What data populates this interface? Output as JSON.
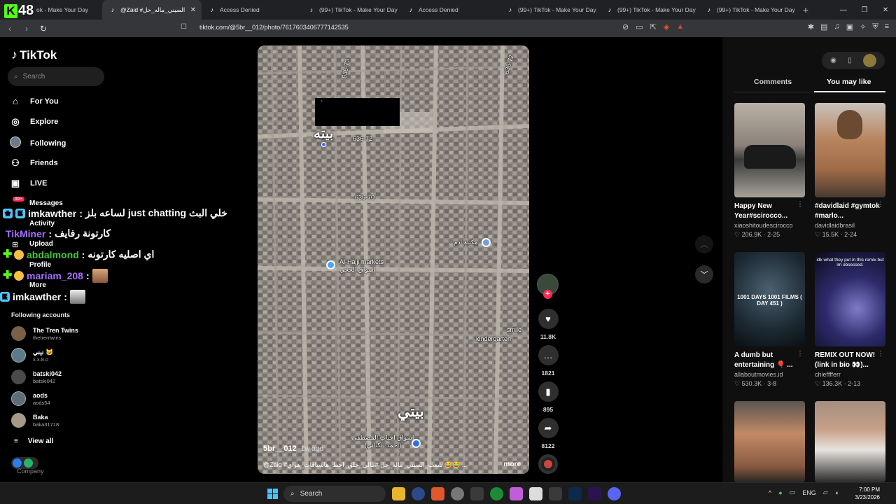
{
  "browser": {
    "tabs": [
      {
        "label": "ok - Make Your Day",
        "active": false
      },
      {
        "label": "@Zaid #الصيني_ماله_حل ...",
        "active": true
      },
      {
        "label": "Access Denied",
        "active": false
      },
      {
        "label": "(99+) TikTok - Make Your Day",
        "active": false
      },
      {
        "label": "Access Denied",
        "active": false
      },
      {
        "label": "(99+) TikTok - Make Your Day",
        "active": false
      },
      {
        "label": "(99+) TikTok - Make Your Day",
        "active": false
      },
      {
        "label": "(99+) TikTok - Make Your Day",
        "active": false
      }
    ],
    "url": "tiktok.com/@5br__012/photo/7617603406777142535"
  },
  "overlay": {
    "kick_number": "48",
    "chat": [
      {
        "user": "imkawther",
        "sep": ":",
        "msg": "لساعه بلز just chatting خلي البث"
      },
      {
        "user": "TikMiner",
        "sep": ":",
        "msg": "كارتونة رفايف"
      },
      {
        "user": "abdalmond",
        "sep": ":",
        "msg": "اي اصليه كارتونه"
      },
      {
        "user": "mariam_208",
        "sep": ":",
        "msg": ""
      },
      {
        "user": "imkawther",
        "sep": ":",
        "msg": ""
      }
    ]
  },
  "sidebar": {
    "logo": "TikTok",
    "search_placeholder": "Search",
    "nav": [
      {
        "label": "For You",
        "icon": "home-icon"
      },
      {
        "label": "Explore",
        "icon": "compass-icon"
      },
      {
        "label": "Following",
        "icon": "following-icon"
      },
      {
        "label": "Friends",
        "icon": "friends-icon"
      },
      {
        "label": "LIVE",
        "icon": "live-icon"
      }
    ],
    "nav_small": [
      "Messages",
      "Activity",
      "Upload",
      "Profile",
      "More"
    ],
    "badge_count": "99+",
    "following_title": "Following accounts",
    "accounts": [
      {
        "name": "The Tren Twins",
        "handle": "thetrentwins"
      },
      {
        "name": "نيني 🐱",
        "handle": "x.x.8.o"
      },
      {
        "name": "batski042",
        "handle": "batski042"
      },
      {
        "name": "aods",
        "handle": "aods54"
      },
      {
        "name": "Baka",
        "handle": "baka31718"
      }
    ],
    "view_all": "View all",
    "company": "Company"
  },
  "video": {
    "labels": {
      "road1": "636-72",
      "road2": "636-70",
      "road3": "636-73",
      "road4": "636-72",
      "market_en": "Al-Hajji markets",
      "market_ar": "اسواق الحجي",
      "school": "smile",
      "kindergarten": "kindergarten",
      "place_ar": "مكتبة ادم",
      "bottom_ar": "اسواق احباب المصطفى (احمد الكناني)"
    },
    "big_text_top": "بيته",
    "big_text_bottom": "بيتي",
    "username": "5br__012",
    "time_ago": "1w ago",
    "caption": "@Zaid #شعب_الصيني_ماله_حل #مالي_خلق_احط_هاشتاقات_هواي 😂😂 ...",
    "more": "more"
  },
  "actions": {
    "likes": "11.8K",
    "comments": "1821",
    "saves": "895",
    "shares": "8122"
  },
  "right_panel": {
    "tabs": [
      "Comments",
      "You may like"
    ],
    "active_tab": "You may like",
    "cards": [
      {
        "title": "Happy New Year#scirocco...",
        "author": "xiaoshitoudescirocco",
        "likes": "206.9K",
        "date": "2-25",
        "thumb_text": ""
      },
      {
        "title": "#davidlaid #gymtok #marlo...",
        "author": "davidlaidbrasil",
        "likes": "15.5K",
        "date": "2-24",
        "thumb_text": ""
      },
      {
        "title": "A dumb but entertaining 🎈 ...",
        "author": "allaboutmovies.id",
        "likes": "530.3K",
        "date": "3-8",
        "thumb_text": "1001 DAYS 1001 FILMS ( DAY 451 )"
      },
      {
        "title": "REMIX OUT NOW! (link in bio 👀)...",
        "author": "chiefffferr",
        "likes": "136.3K",
        "date": "2-13",
        "thumb_text": "idk what they put in this remix but im obsessed."
      },
      {
        "title": "",
        "author": "",
        "likes": "",
        "date": "",
        "thumb_text": ""
      },
      {
        "title": "",
        "author": "",
        "likes": "",
        "date": "",
        "thumb_text": ""
      }
    ]
  },
  "taskbar": {
    "search": "Search",
    "lang": "ENG",
    "time": "7:00 PM",
    "date": "3/23/2026"
  }
}
